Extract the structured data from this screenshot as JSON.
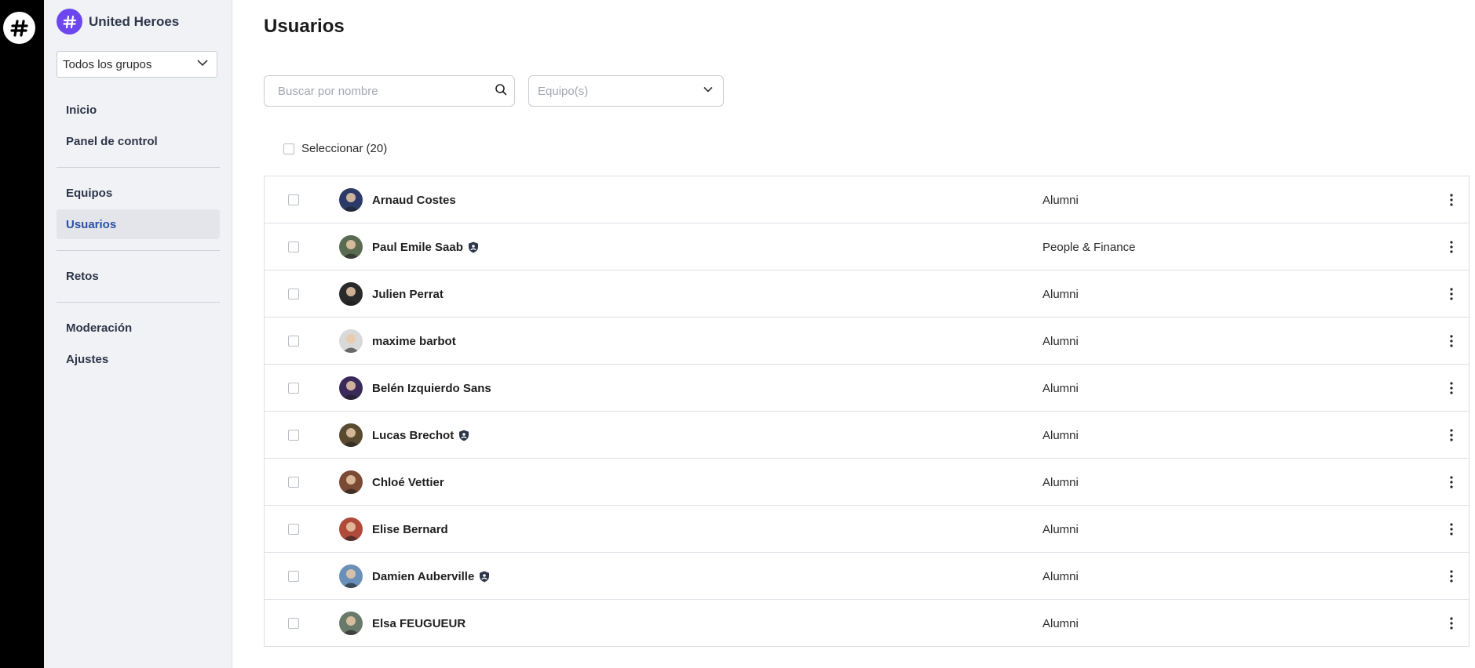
{
  "brand": {
    "name": "United Heroes",
    "accent": "#6c47ef"
  },
  "sidebar": {
    "group_select": "Todos los grupos",
    "items": [
      {
        "label": "Inicio",
        "active": false
      },
      {
        "label": "Panel de control",
        "active": false
      },
      {
        "label": "Equipos",
        "active": false
      },
      {
        "label": "Usuarios",
        "active": true
      },
      {
        "label": "Retos",
        "active": false
      },
      {
        "label": "Moderación",
        "active": false
      },
      {
        "label": "Ajustes",
        "active": false
      }
    ]
  },
  "main": {
    "title": "Usuarios",
    "search_placeholder": "Buscar por nombre",
    "team_placeholder": "Equipo(s)",
    "select_all": "Seleccionar (20)"
  },
  "users": [
    {
      "name": "Arnaud Costes",
      "team": "Alumni",
      "admin": false,
      "avatar_color": "#2b3a67"
    },
    {
      "name": "Paul Emile Saab",
      "team": "People & Finance",
      "admin": true,
      "avatar_color": "#5b6b52"
    },
    {
      "name": "Julien Perrat",
      "team": "Alumni",
      "admin": false,
      "avatar_color": "#2a2a2a"
    },
    {
      "name": "maxime barbot",
      "team": "Alumni",
      "admin": false,
      "avatar_color": "#d9d9d9"
    },
    {
      "name": "Belén Izquierdo Sans",
      "team": "Alumni",
      "admin": false,
      "avatar_color": "#3a2a5a"
    },
    {
      "name": "Lucas Brechot",
      "team": "Alumni",
      "admin": true,
      "avatar_color": "#5a4a30"
    },
    {
      "name": "Chloé Vettier",
      "team": "Alumni",
      "admin": false,
      "avatar_color": "#7a4a34"
    },
    {
      "name": "Elise Bernard",
      "team": "Alumni",
      "admin": false,
      "avatar_color": "#b04a3a"
    },
    {
      "name": "Damien Auberville",
      "team": "Alumni",
      "admin": true,
      "avatar_color": "#6a8fb8"
    },
    {
      "name": "Elsa FEUGUEUR",
      "team": "Alumni",
      "admin": false,
      "avatar_color": "#6a7a6a"
    }
  ]
}
